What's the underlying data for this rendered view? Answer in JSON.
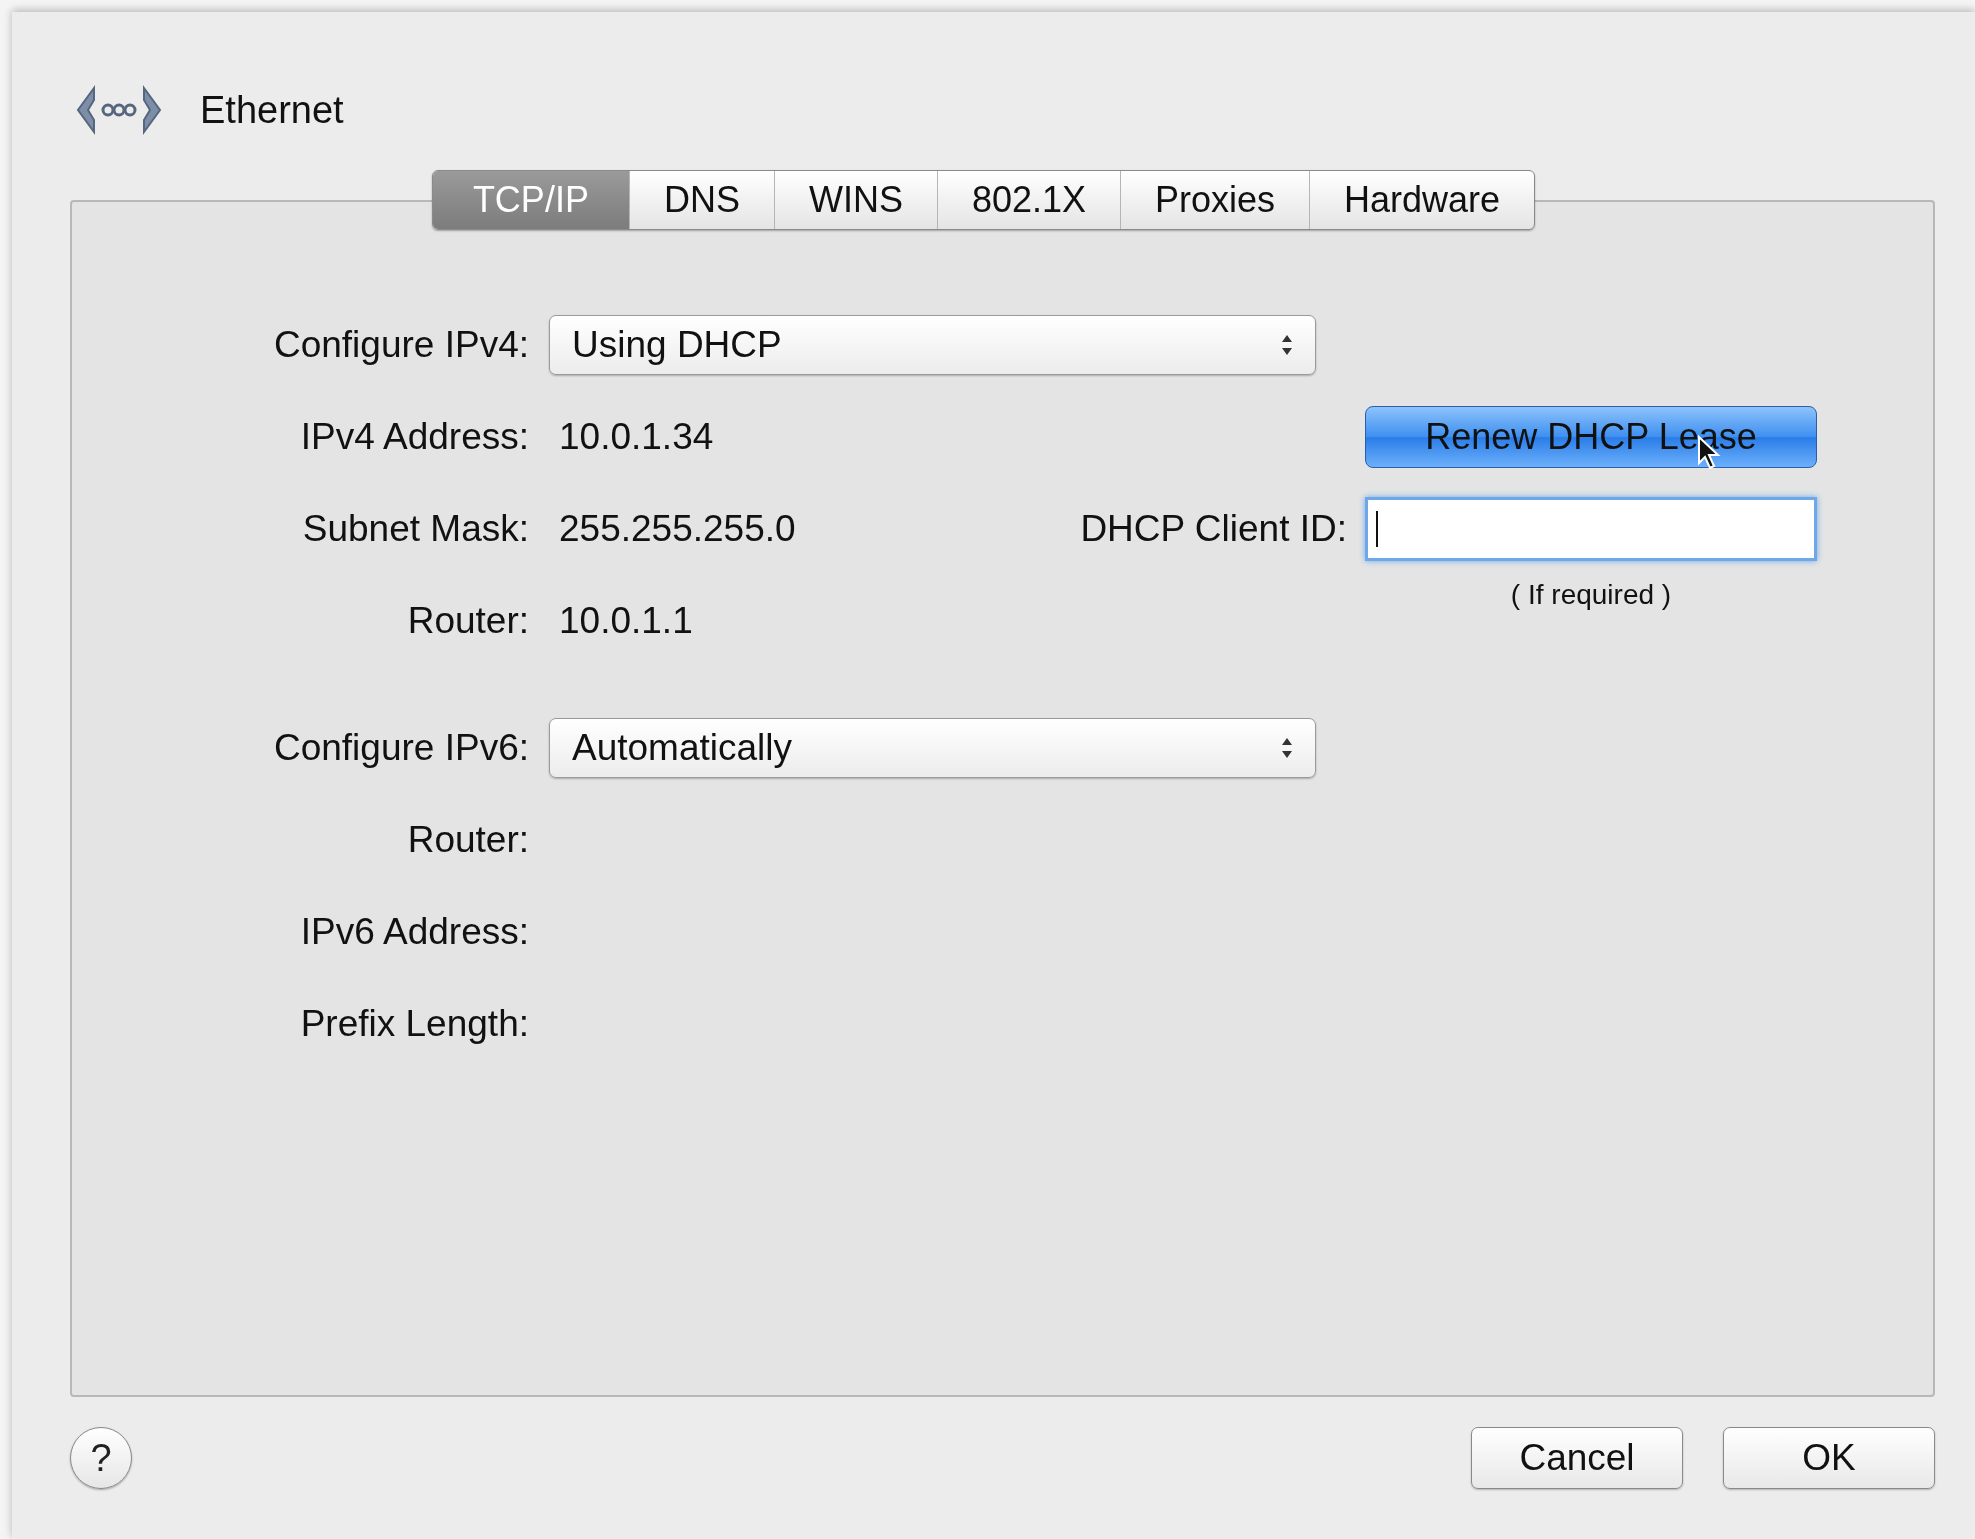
{
  "window": {
    "title": "Ethernet"
  },
  "tabs": [
    {
      "label": "TCP/IP",
      "selected": true
    },
    {
      "label": "DNS",
      "selected": false
    },
    {
      "label": "WINS",
      "selected": false
    },
    {
      "label": "802.1X",
      "selected": false
    },
    {
      "label": "Proxies",
      "selected": false
    },
    {
      "label": "Hardware",
      "selected": false
    }
  ],
  "ipv4": {
    "configure": {
      "label": "Configure IPv4:",
      "value": "Using DHCP"
    },
    "fields": [
      {
        "label": "IPv4 Address:",
        "value": "10.0.1.34"
      },
      {
        "label": "Subnet Mask:",
        "value": "255.255.255.0"
      },
      {
        "label": "Router:",
        "value": "10.0.1.1"
      }
    ]
  },
  "renew_button": {
    "label": "Renew DHCP Lease"
  },
  "client_id": {
    "label": "DHCP Client ID:",
    "focused": true,
    "note": "( If required )"
  },
  "ipv6": {
    "configure": {
      "label": "Configure IPv6:",
      "value": "Automatically"
    },
    "fields": [
      {
        "label": "Router:"
      },
      {
        "label": "IPv6 Address:"
      },
      {
        "label": "Prefix Length:"
      }
    ]
  },
  "help_button": {
    "label": "?"
  },
  "buttons": [
    {
      "label": "Cancel"
    },
    {
      "label": "OK"
    }
  ]
}
